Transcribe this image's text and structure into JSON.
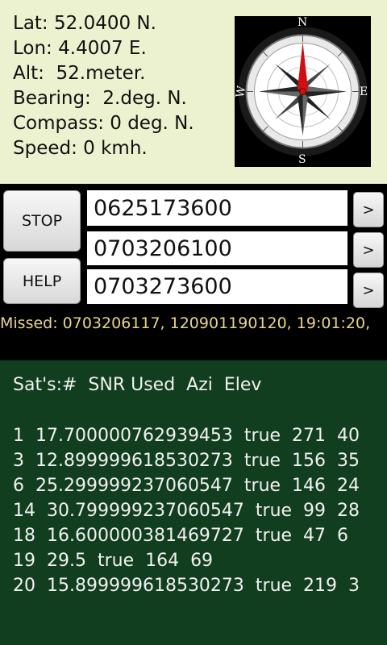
{
  "info": {
    "lat": "Lat: 52.0400 N.",
    "lon": "Lon: 4.4007 E.",
    "alt": "Alt:  52.meter.",
    "bearing": "Bearing:  2.deg. N.",
    "compass": "Compass: 0 deg. N.",
    "speed": "Speed: 0 kmh."
  },
  "compass_dial": {
    "north": "N",
    "east": "E",
    "south": "S",
    "west": "W",
    "needle_color": "#d01010"
  },
  "controls": {
    "stop_label": "STOP",
    "help_label": "HELP",
    "numbers": [
      "0625173600",
      "0703206100",
      "0703273600"
    ],
    "go_label": ">"
  },
  "missed": "Missed: 0703206117, 120901190120, 19:01:20,",
  "sats": {
    "header": "Sat's:#  SNR Used  Azi  Elev",
    "rows": [
      "1  17.700000762939453  true  271  40",
      "3  12.899999618530273  true  156  35",
      "6  25.299999237060547  true  146  24",
      "14  30.799999237060547  true  99  28",
      "18  16.600000381469727  true  47  6",
      "19  29.5  true  164  69",
      "20  15.899999618530273  true  219  3"
    ]
  },
  "colors": {
    "top_bg": "#ecf1cf",
    "sat_bg": "#123e20",
    "missed_text": "#e8d48c"
  }
}
